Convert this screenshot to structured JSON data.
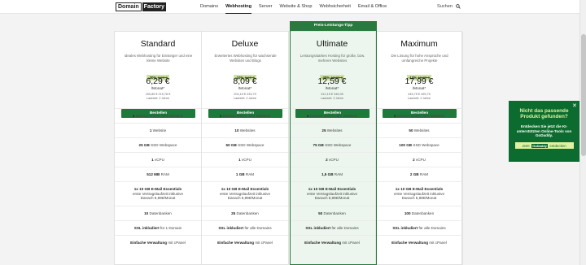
{
  "header": {
    "logo_left": "Domain",
    "logo_right": "Factory",
    "nav": [
      "Domains",
      "Webhosting",
      "Server",
      "Website & Shop",
      "Webhsicherheit",
      "Email & Office"
    ],
    "nav_active_index": 1,
    "search_label": "Suchen"
  },
  "ribbon": "Preis-Leistungs-Tipp",
  "plans": [
    {
      "name": "Standard",
      "description": "Ideales Webhosting für Einsteiger und eine kleine Website",
      "discount_pct": "-30%",
      "old_price": "8,99 €",
      "price": "6,29 €",
      "per": "/Monat*",
      "total": "150,85 € 215,78 €",
      "term": "Laufzeit: 2 Jahre",
      "button": "Bestellen",
      "features": [
        [
          "1",
          " Domain",
          " erstes Jahr inklusive"
        ],
        [
          "1",
          " Website",
          ""
        ],
        [
          "25 GB",
          " SSD Webspace",
          ""
        ],
        [
          "1",
          " vCPU",
          ""
        ],
        [
          "512 MB",
          " RAM",
          ""
        ],
        [
          "1x 10 GB E-Mail Essentials",
          "",
          "erste Vertragslaufzeit inklusive|Danach 5,99€/Monat"
        ],
        [
          "10",
          " Datenbanken",
          ""
        ],
        [
          "SSL inkludiert",
          " für 1 Domain",
          ""
        ],
        [
          "Einfache Verwaltung",
          " mit cPanel",
          ""
        ]
      ]
    },
    {
      "name": "Deluxe",
      "description": "Erweitertes Webhosting für wachsende Websites und Blogs",
      "discount_pct": "-10%",
      "old_price": "8,90 €",
      "price": "8,09 €",
      "per": "/Monat*",
      "total": "204,15 € 233,79",
      "term": "Laufzeit: 2 Jahre",
      "button": "Bestellen",
      "features": [
        [
          "1",
          " Domain",
          " erstes Jahr inklusive"
        ],
        [
          "10",
          " Websites",
          ""
        ],
        [
          "50 GB",
          " SSD Webspace",
          ""
        ],
        [
          "1",
          " vCPU",
          ""
        ],
        [
          "1 GB",
          " RAM",
          ""
        ],
        [
          "1x 10 GB E-Mail Essentials",
          "",
          "erste Vertragslaufzeit inklusive|Danach 5,99€/Monat"
        ],
        [
          "25",
          " Datenbanken",
          ""
        ],
        [
          "SSL inkludiert",
          " für alle Domains",
          ""
        ],
        [
          "Einfache Verwaltung",
          " mit cPanel",
          ""
        ]
      ]
    },
    {
      "name": "Ultimate",
      "description": "Leistungsstarkes Hosting für große, bzw. mehrere Websites",
      "discount_pct": "-30%",
      "old_price": "13,99 €",
      "price": "12,59 €",
      "per": "/Monat*",
      "total": "312,15 € 346,95",
      "term": "Laufzeit: 2 Jahre",
      "button": "Bestellen",
      "features": [
        [
          "1",
          " Domain",
          " erstes Jahr inklusive"
        ],
        [
          "25",
          " Websites",
          ""
        ],
        [
          "75 GB",
          " SSD Webspace",
          ""
        ],
        [
          "2",
          " vCPU",
          ""
        ],
        [
          "1,5 GB",
          " RAM",
          ""
        ],
        [
          "1x 10 GB E-Mail Essentials",
          "",
          "erste Vertragslaufzeit inklusive|Danach 5,99€/Monat"
        ],
        [
          "50",
          " Datenbanken",
          ""
        ],
        [
          "SSL inkludiert",
          " für alle Domains",
          ""
        ],
        [
          "Einfache Verwaltung",
          " mit cPanel",
          ""
        ]
      ]
    },
    {
      "name": "Maximum",
      "description": "Die Lösung für hohe Ansprüche und umfangreiche Projekte",
      "discount_pct": "-10%",
      "old_price": "19,99 €",
      "price": "17,99 €",
      "per": "/Monat*",
      "total": "445,75 € 499,75",
      "term": "Laufzeit: 2 Jahre",
      "button": "Bestellen",
      "features": [
        [
          "1",
          " Domain",
          " erstes Jahr inklusive"
        ],
        [
          "50",
          " Websites",
          ""
        ],
        [
          "100 GB",
          " SSD Webspace",
          ""
        ],
        [
          "2",
          " vCPU",
          ""
        ],
        [
          "2 GB",
          " RAM",
          ""
        ],
        [
          "1x 10 GB E-Mail Essentials",
          "",
          "erste Vertragslaufzeit inklusive|Danach 5,99€/Monat"
        ],
        [
          "100",
          " Datenbanken",
          ""
        ],
        [
          "SSL inkludiert",
          " für alle Domains",
          ""
        ],
        [
          "Einfache Verwaltung",
          " mit cPanel",
          ""
        ]
      ]
    }
  ],
  "promo": {
    "close": "✕",
    "title": "Nicht das passende Produkt gefunden?",
    "body": "Entdecken Sie jetzt die KI-unterstützten Online-Tools von GoDaddy.",
    "cta_pre": "Jetzt",
    "cta_brand": "GoDaddy",
    "cta_post": "entdecken"
  },
  "colors": {
    "accent_green": "#1e7a3a",
    "highlight_bg": "#ecf6ee",
    "discount_badge": "#cfe59b"
  }
}
